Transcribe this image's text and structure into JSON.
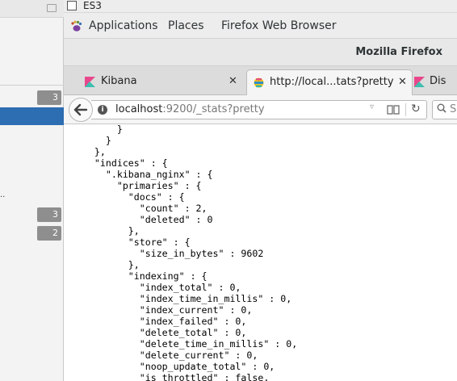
{
  "top_strip": {
    "title": "ES3"
  },
  "menubar": {
    "applications": "Applications",
    "places": "Places",
    "firefox": "Firefox Web Browser"
  },
  "window": {
    "title": "Mozilla Firefox"
  },
  "tabs": [
    {
      "label": "Kibana",
      "close": "✕"
    },
    {
      "label": "http://local...tats?pretty",
      "close": "✕"
    },
    {
      "label": "Dis"
    }
  ],
  "url": {
    "host": "localhost",
    "rest": ":9200/_stats?pretty"
  },
  "search": {
    "placeholder": "S"
  },
  "left_panel": {
    "badges": [
      "3",
      "3",
      "2"
    ],
    "ellipsis": ".."
  },
  "json_lines": [
    "        }",
    "      }",
    "    },",
    "    \"indices\" : {",
    "      \".kibana_nginx\" : {",
    "        \"primaries\" : {",
    "          \"docs\" : {",
    "            \"count\" : 2,",
    "            \"deleted\" : 0",
    "          },",
    "          \"store\" : {",
    "            \"size_in_bytes\" : 9602",
    "          },",
    "          \"indexing\" : {",
    "            \"index_total\" : 0,",
    "            \"index_time_in_millis\" : 0,",
    "            \"index_current\" : 0,",
    "            \"index_failed\" : 0,",
    "            \"delete_total\" : 0,",
    "            \"delete_time_in_millis\" : 0,",
    "            \"delete_current\" : 0,",
    "            \"noop_update_total\" : 0,",
    "            \"is_throttled\" : false,"
  ]
}
